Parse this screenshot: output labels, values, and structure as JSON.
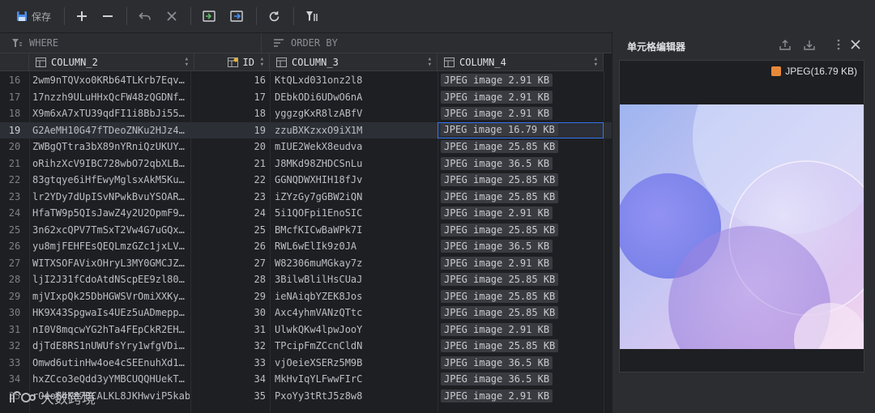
{
  "toolbar": {
    "save_label": "保存"
  },
  "filter": {
    "where_label": "WHERE",
    "order_label": "ORDER BY"
  },
  "columns": {
    "col2": "COLUMN_2",
    "id": "ID",
    "col3": "COLUMN_3",
    "col4": "COLUMN_4"
  },
  "rows": [
    {
      "num": "16",
      "c2": "2wm9nTQVxo0KRb64TLKrb7Eqv…",
      "id": "16",
      "c3": "KtQLxd031onz2l8",
      "c4": "JPEG image 2.91 KB"
    },
    {
      "num": "17",
      "c2": "17nzzh9ULuHHxQcFW48zQGDNf…",
      "id": "17",
      "c3": "DEbkODi6UDwO6nA",
      "c4": "JPEG image 2.91 KB"
    },
    {
      "num": "18",
      "c2": "X9m6xA7xTU39qdFI1i8BbJi55…",
      "id": "18",
      "c3": "yggzgKxR8lzABfV",
      "c4": "JPEG image 2.91 KB"
    },
    {
      "num": "19",
      "c2": "G2AeMH10G47fTDeoZNKu2HJz4…",
      "id": "19",
      "c3": "zzuBXKzxxO9iX1M",
      "c4": "JPEG image 16.79 KB"
    },
    {
      "num": "20",
      "c2": "ZWBgQTtra3bX89nYRniQzUKUY…",
      "id": "20",
      "c3": "mIUE2WekX8eudva",
      "c4": "JPEG image 25.85 KB"
    },
    {
      "num": "21",
      "c2": "oRihzXcV9IBC728wbO72qbXLB…",
      "id": "21",
      "c3": "J8MKd98ZHDCSnLu",
      "c4": "JPEG image 36.5 KB"
    },
    {
      "num": "22",
      "c2": "83gtqye6iHfEwyMglsxAkM5Ku…",
      "id": "22",
      "c3": "GGNQDWXHIH18fJv",
      "c4": "JPEG image 25.85 KB"
    },
    {
      "num": "23",
      "c2": "lr2YDy7dUpISvNPwkBvuYSOAR…",
      "id": "23",
      "c3": "iZYzGy7gGBW2iQN",
      "c4": "JPEG image 25.85 KB"
    },
    {
      "num": "24",
      "c2": "HfaTW9p5QIsJawZ4y2U2OpmF9…",
      "id": "24",
      "c3": "5i1QOFpi1EnoSIC",
      "c4": "JPEG image 2.91 KB"
    },
    {
      "num": "25",
      "c2": "3n62xcQPV7TmSxT2Vw4G7uGQx…",
      "id": "25",
      "c3": "BMcfKICwBaWPk7I",
      "c4": "JPEG image 25.85 KB"
    },
    {
      "num": "26",
      "c2": "yu8mjFEHFEsQEQLmzGZc1jxLV…",
      "id": "26",
      "c3": "RWL6wElIk9z0JA",
      "c4": "JPEG image 36.5 KB"
    },
    {
      "num": "27",
      "c2": "WITXSOFAVixOHryL3MY0GMCJZ…",
      "id": "27",
      "c3": "W82306muMGkay7z",
      "c4": "JPEG image 2.91 KB"
    },
    {
      "num": "28",
      "c2": "ljI2J31fCdoAtdNScpEE9zl80…",
      "id": "28",
      "c3": "3BilwBlilHsCUaJ",
      "c4": "JPEG image 25.85 KB"
    },
    {
      "num": "29",
      "c2": "mjVIxpQk25DbHGWSVrOmiXXKy…",
      "id": "29",
      "c3": "ieNAiqbYZEK8Jos",
      "c4": "JPEG image 25.85 KB"
    },
    {
      "num": "30",
      "c2": "HK9X43SpgwaIs4UEz5uADmepp…",
      "id": "30",
      "c3": "Axc4yhmVANzQTtc",
      "c4": "JPEG image 25.85 KB"
    },
    {
      "num": "31",
      "c2": "nI0V8mqcwYG2hTa4FEpCkR2EH…",
      "id": "31",
      "c3": "UlwkQKw4lpwJooY",
      "c4": "JPEG image 2.91 KB"
    },
    {
      "num": "32",
      "c2": "djTdE8RS1nUWUfsYry1wfgVDi…",
      "id": "32",
      "c3": "TPcipFmZCcnCldN",
      "c4": "JPEG image 25.85 KB"
    },
    {
      "num": "33",
      "c2": "Omwd6utinHw4oe4cSEEnuhXd1…",
      "id": "33",
      "c3": "vjOeieXSERz5M9B",
      "c4": "JPEG image 36.5 KB"
    },
    {
      "num": "34",
      "c2": "hxZCco3eQdd3yYMBCUQQHUekT…",
      "id": "34",
      "c3": "MkHvIqYLFwwFIrC",
      "c4": "JPEG image 36.5 KB"
    },
    {
      "num": "35",
      "c2": "rOeoG4K87BCALKL8JKHwviP5kab…",
      "id": "35",
      "c3": "PxoYy3tRtJ5z8w8",
      "c4": "JPEG image 2.91 KB"
    }
  ],
  "selected_row": "19",
  "panel": {
    "title": "单元格编辑器",
    "image_meta": "JPEG(16.79 KB)"
  },
  "watermark": "大数跨境",
  "colors": {
    "accent": "#3574f0",
    "background": "#1e1f22",
    "toolbar": "#2b2d30"
  }
}
